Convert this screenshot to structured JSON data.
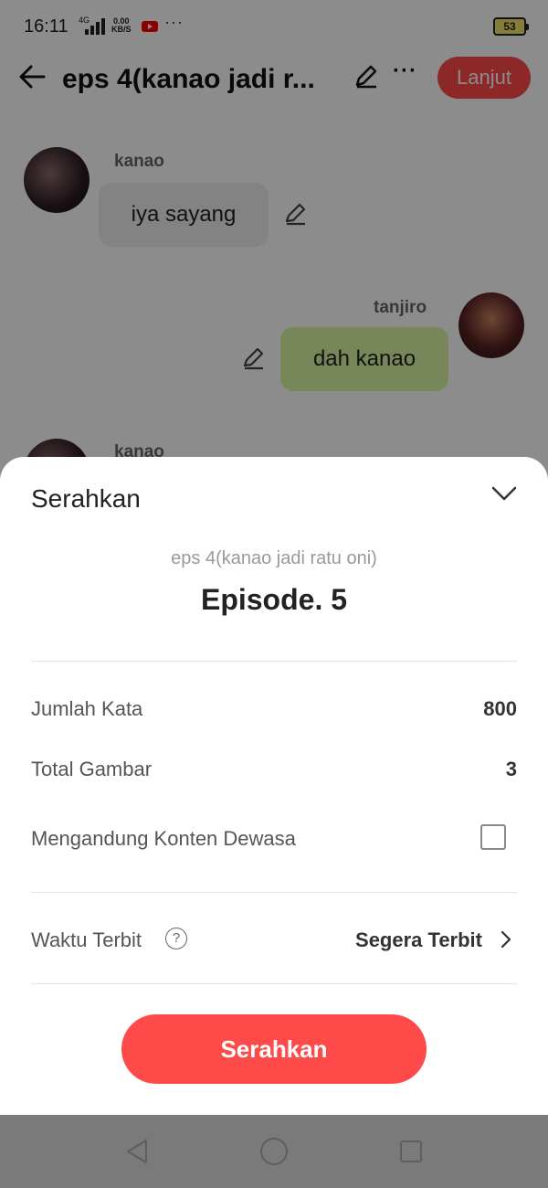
{
  "status_bar": {
    "time": "16:11",
    "network": "4G",
    "speed_value": "0.00",
    "speed_unit": "KB/S",
    "more": "···",
    "battery": "53"
  },
  "header": {
    "title": "eps 4(kanao jadi r...",
    "lanjut_label": "Lanjut"
  },
  "chat": {
    "messages": [
      {
        "sender": "kanao",
        "text": "iya sayang"
      },
      {
        "sender": "tanjiro",
        "text": "dah kanao"
      },
      {
        "sender": "kanao"
      }
    ]
  },
  "sheet": {
    "title": "Serahkan",
    "story_title": "eps 4(kanao jadi ratu oni)",
    "episode": "Episode. 5",
    "rows": {
      "word_count": {
        "label": "Jumlah Kata",
        "value": "800"
      },
      "image_count": {
        "label": "Total Gambar",
        "value": "3"
      },
      "adult_content": {
        "label": "Mengandung Konten Dewasa"
      },
      "publish_time": {
        "label": "Waktu Terbit",
        "help": "?",
        "value": "Segera Terbit"
      }
    },
    "submit_label": "Serahkan"
  },
  "colors": {
    "accent": "#ff4a4a",
    "bubble_right": "#d9f6a2",
    "bubble_left": "#eeeeee"
  }
}
